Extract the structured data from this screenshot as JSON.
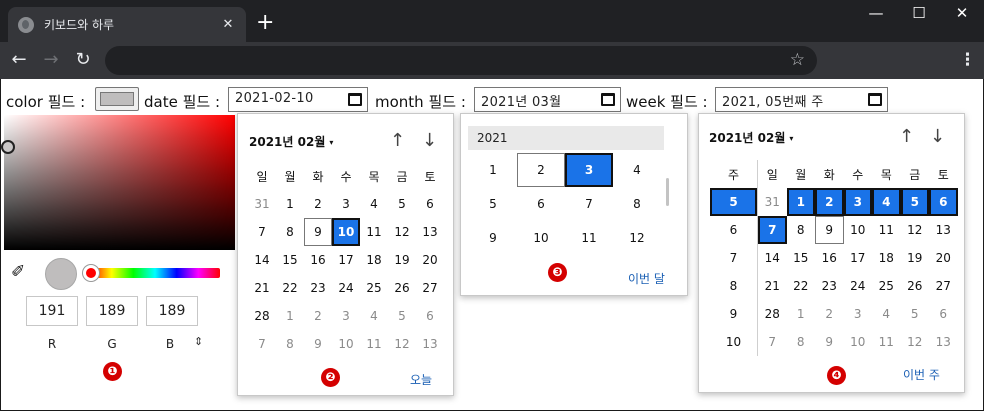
{
  "browser": {
    "tab_title": "키보드와 하루",
    "tab_close": "✕",
    "new_tab": "+",
    "window_controls": [
      "—",
      "☐",
      "✕"
    ],
    "nav": {
      "back": "←",
      "forward": "→",
      "reload": "↻",
      "bookmark": "☆",
      "menu": "⋮"
    }
  },
  "form": {
    "color_label": "color 필드 :",
    "date_label": "date 필드 :",
    "date_value": "2021-02-10",
    "month_label": "month 필드 :",
    "month_value": "2021년 03월",
    "week_label": "week 필드 :",
    "week_value": "2021, 05번째 주"
  },
  "colors": {
    "selected_color": "#bfbdbd",
    "accent": "#1a73e8",
    "badge": "#d40000"
  },
  "color_picker": {
    "r": "191",
    "g": "189",
    "b": "189",
    "labels": {
      "r": "R",
      "g": "G",
      "b": "B"
    },
    "format_toggle": "⇕",
    "badge": "❶"
  },
  "date_picker": {
    "header": "2021년 02월",
    "caret": "▾",
    "prev": "↑",
    "next": "↓",
    "weekdays": [
      "일",
      "월",
      "화",
      "수",
      "목",
      "금",
      "토"
    ],
    "days": [
      [
        "31",
        "1",
        "2",
        "3",
        "4",
        "5",
        "6"
      ],
      [
        "7",
        "8",
        "9",
        "10",
        "11",
        "12",
        "13"
      ],
      [
        "14",
        "15",
        "16",
        "17",
        "18",
        "19",
        "20"
      ],
      [
        "21",
        "22",
        "23",
        "24",
        "25",
        "26",
        "27"
      ],
      [
        "28",
        "1",
        "2",
        "3",
        "4",
        "5",
        "6"
      ],
      [
        "7",
        "8",
        "9",
        "10",
        "11",
        "12",
        "13"
      ]
    ],
    "selected": "10",
    "today": "9",
    "today_link": "오늘",
    "badge": "❷"
  },
  "month_picker": {
    "year": "2021",
    "months": [
      [
        "1",
        "2",
        "3",
        "4"
      ],
      [
        "5",
        "6",
        "7",
        "8"
      ],
      [
        "9",
        "10",
        "11",
        "12"
      ]
    ],
    "selected": "3",
    "current": "2",
    "this_month_link": "이번 달",
    "badge": "❸"
  },
  "week_picker": {
    "header": "2021년 02월",
    "caret": "▾",
    "prev": "↑",
    "next": "↓",
    "week_header": "주",
    "weekdays": [
      "일",
      "월",
      "화",
      "수",
      "목",
      "금",
      "토"
    ],
    "weeks": [
      {
        "wk": "5",
        "days": [
          "31",
          "1",
          "2",
          "3",
          "4",
          "5",
          "6"
        ]
      },
      {
        "wk": "6",
        "days": [
          "7",
          "8",
          "9",
          "10",
          "11",
          "12",
          "13"
        ]
      },
      {
        "wk": "7",
        "days": [
          "14",
          "15",
          "16",
          "17",
          "18",
          "19",
          "20"
        ]
      },
      {
        "wk": "8",
        "days": [
          "21",
          "22",
          "23",
          "24",
          "25",
          "26",
          "27"
        ]
      },
      {
        "wk": "9",
        "days": [
          "28",
          "1",
          "2",
          "3",
          "4",
          "5",
          "6"
        ]
      },
      {
        "wk": "10",
        "days": [
          "7",
          "8",
          "9",
          "10",
          "11",
          "12",
          "13"
        ]
      }
    ],
    "selected_week": "5",
    "selected_day": "7",
    "today": "9",
    "this_week_link": "이번 주",
    "badge": "❹"
  }
}
